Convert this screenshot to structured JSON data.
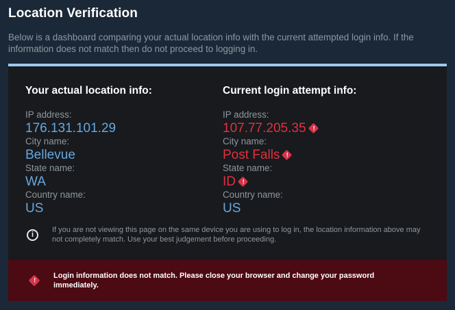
{
  "header": {
    "title": "Location Verification",
    "description": "Below is a dashboard comparing your actual location info with the current attempted login info. If the information does not match then do not proceed to logging in."
  },
  "colors": {
    "accent": "#9ec8ee",
    "match": "#66a8e0",
    "mismatch": "#e2303f",
    "alert_bg": "#4c0a13"
  },
  "actual": {
    "heading": "Your actual location info:",
    "fields": [
      {
        "label": "IP address:",
        "value": "176.131.101.29"
      },
      {
        "label": "City name:",
        "value": "Bellevue"
      },
      {
        "label": "State name:",
        "value": "WA"
      },
      {
        "label": "Country name:",
        "value": "US"
      }
    ]
  },
  "attempt": {
    "heading": "Current login attempt info:",
    "fields": [
      {
        "label": "IP address:",
        "value": "107.77.205.35",
        "mismatch": true
      },
      {
        "label": "City name:",
        "value": "Post Falls",
        "mismatch": true
      },
      {
        "label": "State name:",
        "value": "ID",
        "mismatch": true
      },
      {
        "label": "Country name:",
        "value": "US",
        "mismatch": false
      }
    ]
  },
  "info": {
    "icon": "info-icon",
    "text": "If you are not viewing this page on the same device you are using to log in, the location information above may not completely match. Use your best judgement before proceeding."
  },
  "alert": {
    "icon": "warning-icon",
    "text": "Login information does not match. Please close your browser and change your password immediately."
  }
}
